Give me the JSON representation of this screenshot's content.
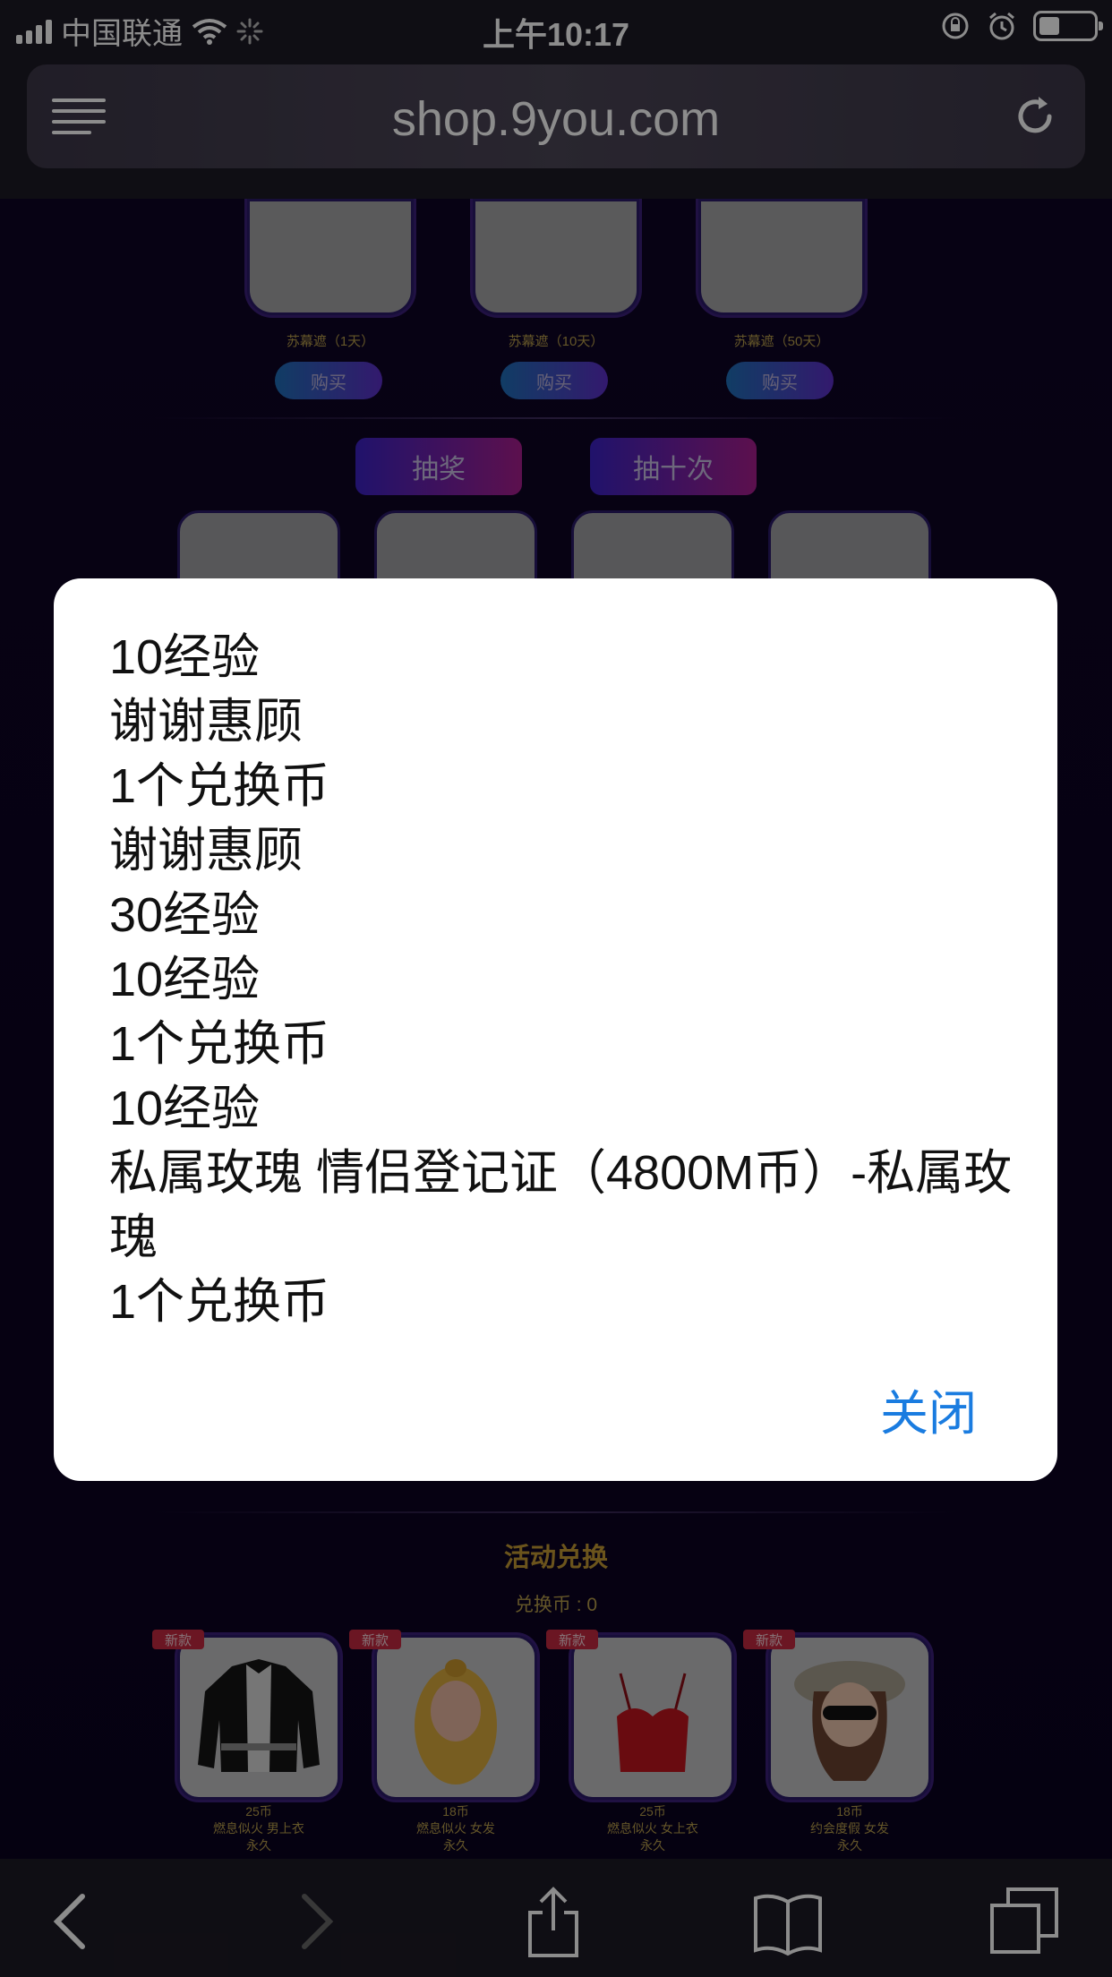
{
  "status_bar": {
    "carrier": "中国联通",
    "time": "上午10:17"
  },
  "browser": {
    "url": "shop.9you.com"
  },
  "shop_items": [
    {
      "label": "苏幕遮（1天）",
      "buy": "购买"
    },
    {
      "label": "苏幕遮（10天）",
      "buy": "购买"
    },
    {
      "label": "苏幕遮（50天）",
      "buy": "购买"
    }
  ],
  "lottery": {
    "draw_once": "抽奖",
    "draw_ten": "抽十次"
  },
  "exchange": {
    "title": "活动兑换",
    "coins": "兑换币 : 0",
    "items": [
      {
        "badge": "新款",
        "price": "25币",
        "name": "燃息似火 男上衣",
        "duration": "永久"
      },
      {
        "badge": "新款",
        "price": "18币",
        "name": "燃息似火 女发",
        "duration": "永久"
      },
      {
        "badge": "新款",
        "price": "25币",
        "name": "燃息似火 女上衣",
        "duration": "永久"
      },
      {
        "badge": "新款",
        "price": "18币",
        "name": "约会度假 女发",
        "duration": "永久"
      }
    ]
  },
  "dialog": {
    "lines": [
      "10经验",
      "谢谢惠顾",
      "1个兑换币",
      "谢谢惠顾",
      "30经验",
      "10经验",
      "1个兑换币",
      "10经验",
      "私属玫瑰 情侣登记证（4800M币）-私属玫瑰",
      "1个兑换币"
    ],
    "close_label": "关闭"
  }
}
